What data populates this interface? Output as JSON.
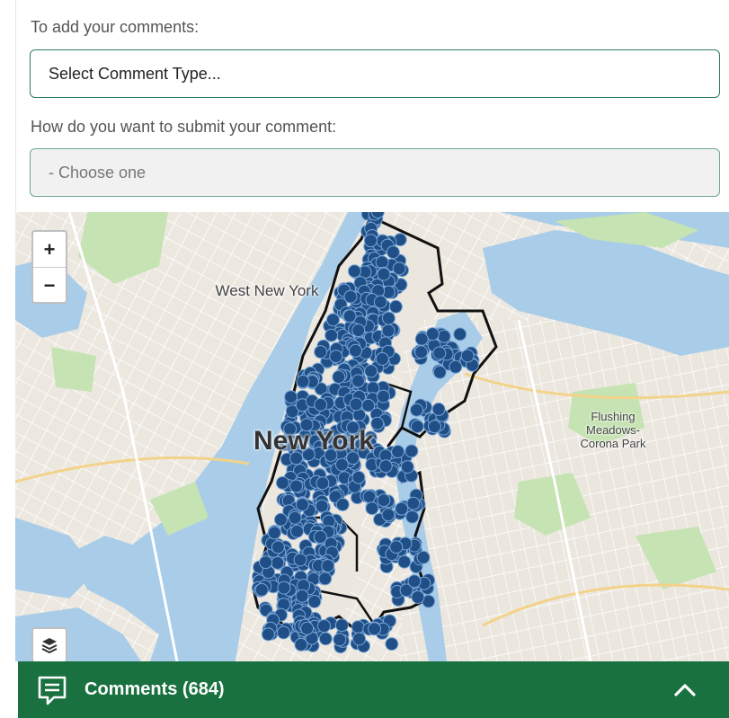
{
  "form": {
    "comment_type_label": "To add your comments:",
    "comment_type_select": "Select Comment Type...",
    "submit_label": "How do you want to submit your comment:",
    "submit_select": "- Choose one"
  },
  "map": {
    "zoom_in": "+",
    "zoom_out": "−",
    "labels": {
      "west_new_york": "West New York",
      "new_york": "New York",
      "flushing": "Flushing Meadows-Corona Park"
    },
    "icons": [
      "plus-icon",
      "minus-icon",
      "layers-icon"
    ],
    "colors": {
      "water": "#a9cde8",
      "marker": "#1f4f86",
      "park": "#c6e3b3",
      "boundary": "#111111"
    }
  },
  "footer": {
    "comments_label": "Comments (684)",
    "accent": "#1a7140"
  }
}
